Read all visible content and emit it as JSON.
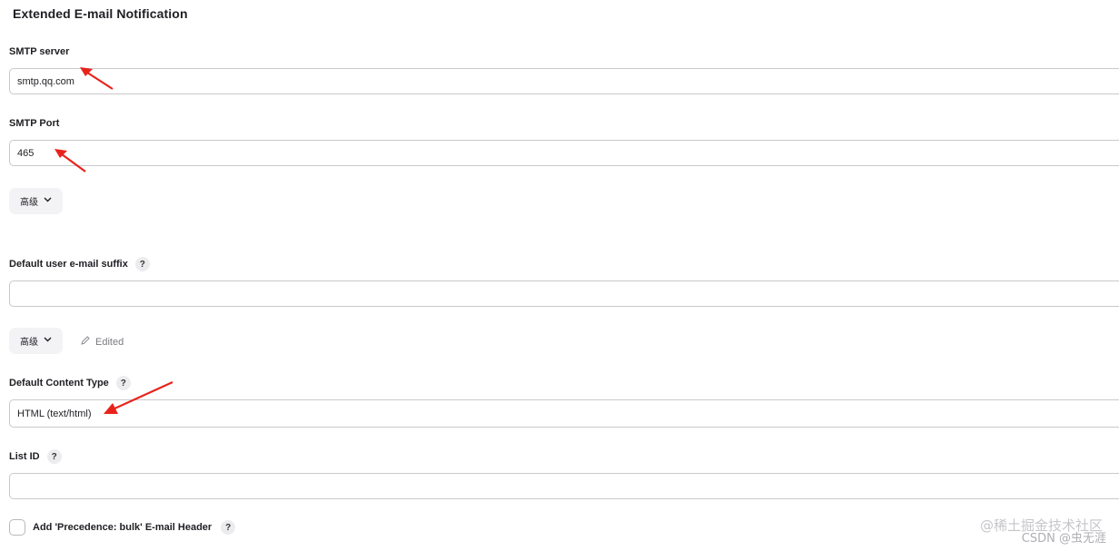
{
  "section": {
    "title": "Extended E-mail Notification"
  },
  "smtp_server": {
    "label": "SMTP server",
    "value": "smtp.qq.com"
  },
  "smtp_port": {
    "label": "SMTP Port",
    "value": "465"
  },
  "advanced_1": {
    "label": "高级",
    "icon": "chevron-down-icon"
  },
  "default_suffix": {
    "label": "Default user e-mail suffix",
    "help": "?",
    "value": ""
  },
  "advanced_2": {
    "label": "高级",
    "icon": "chevron-down-icon",
    "edited": "Edited",
    "edited_icon": "pencil-icon"
  },
  "content_type": {
    "label": "Default Content Type",
    "help": "?",
    "value": "HTML (text/html)"
  },
  "list_id": {
    "label": "List ID",
    "help": "?",
    "value": ""
  },
  "precedence": {
    "label": "Add 'Precedence: bulk' E-mail Header",
    "help": "?",
    "checked": false
  },
  "watermark": {
    "line1": "@稀土掘金技术社区",
    "line2": "CSDN @虫无涯"
  },
  "colors": {
    "annotation_arrow": "#e8231c"
  }
}
